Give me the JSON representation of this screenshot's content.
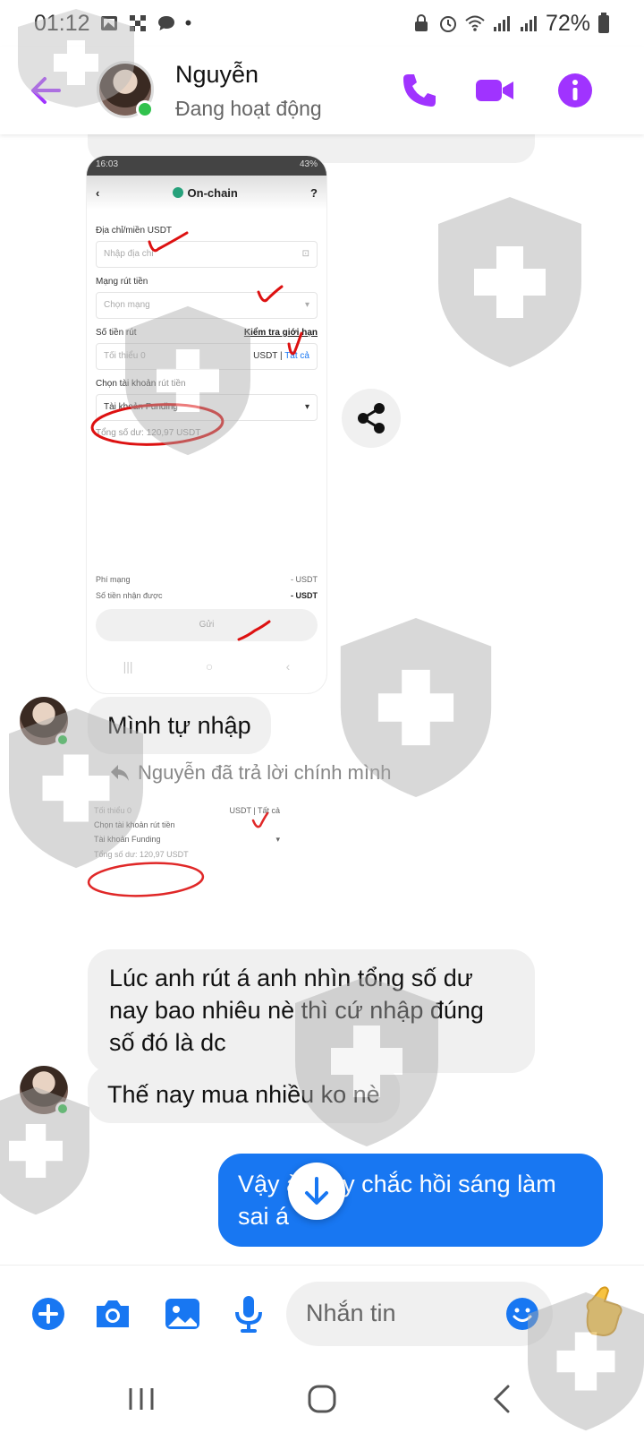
{
  "status_bar": {
    "time": "01:12",
    "battery": "72%"
  },
  "header": {
    "contact_name": "Nguyễn",
    "contact_status": "Đang hoạt động"
  },
  "shared_image": {
    "status_time": "16:03",
    "status_battery": "43%",
    "title": "On-chain",
    "address_label": "Địa chỉ/miền USDT",
    "address_placeholder": "Nhập địa chỉ",
    "network_label": "Mạng rút tiền",
    "network_placeholder": "Chọn mạng",
    "amount_label": "Số tiền rút",
    "amount_link": "Kiểm tra giới hạn",
    "amount_placeholder": "Tối thiểu 0",
    "amount_unit": "USDT",
    "amount_all": "Tất cả",
    "account_label": "Chọn tài khoản rút tiền",
    "account_value": "Tài khoản Funding",
    "balance_text": "Tổng số dư: 120,97 USDT",
    "fee_label": "Phí mạng",
    "fee_value": "- USDT",
    "receive_label": "Số tiền nhận được",
    "receive_value": "- USDT",
    "send_label": "Gửi"
  },
  "messages": {
    "m1": "Mình tự nhập",
    "reply_note": "Nguyễn đã trả lời chính mình",
    "m2": "Lúc anh rút á anh nhìn tổng số dư nay bao nhiêu nè thì cứ nhập đúng số đó là dc",
    "m3": "Thế nay mua nhiều ko nè",
    "m4": "Vậy à. Vậy chắc hồi sáng làm sai á"
  },
  "reply_preview": {
    "amount_placeholder": "Tối thiểu 0",
    "amount_unit": "USDT",
    "amount_all": "Tất cả",
    "account_label": "Chọn tài khoản rút tiền",
    "account_value": "Tài khoản Funding",
    "balance_text": "Tổng số dư: 120,97 USDT"
  },
  "composer": {
    "placeholder": "Nhắn tin"
  },
  "colors": {
    "accent_purple": "#a033ff",
    "messenger_blue": "#1877f2",
    "online_green": "#31c24d"
  }
}
